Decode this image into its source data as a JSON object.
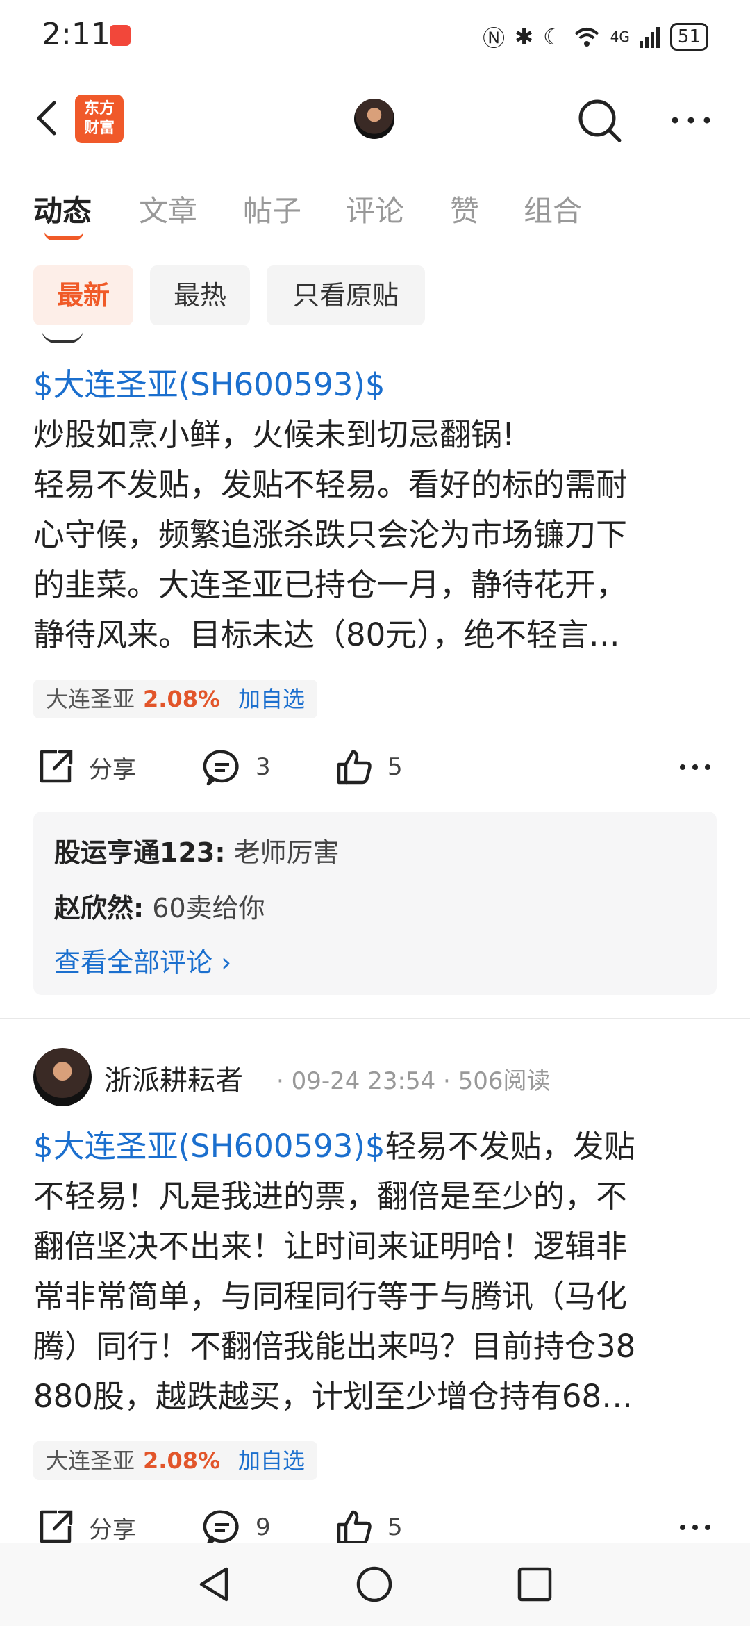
{
  "status": {
    "time": "2:11",
    "battery": "51",
    "network": "4G"
  },
  "header": {
    "logo_line1": "东方",
    "logo_line2": "财富"
  },
  "tabs": [
    {
      "label": "动态",
      "active": true
    },
    {
      "label": "文章"
    },
    {
      "label": "帖子"
    },
    {
      "label": "评论"
    },
    {
      "label": "赞"
    },
    {
      "label": "组合"
    }
  ],
  "filters": [
    {
      "label": "最新",
      "active": true
    },
    {
      "label": "最热"
    },
    {
      "label": "只看原贴"
    }
  ],
  "post1": {
    "link": "$大连圣亚(SH600593)$",
    "line1": "炒股如烹小鲜，火候未到切忌翻锅!",
    "line2": "轻易不发贴，发贴不轻易。看好的标的需耐",
    "line3": "心守候，频繁追涨杀跌只会沦为市场镰刀下",
    "line4": "的韭菜。大连圣亚已持仓一月，静待花开，",
    "line5": "静待风来。目标未达（80元），绝不轻言…",
    "stock": {
      "name": "大连圣亚",
      "change": "2.08%",
      "add": "加自选"
    },
    "actions": {
      "share": "分享",
      "comments": "3",
      "likes": "5"
    },
    "comments": [
      {
        "user": "股运亨通123:",
        "text": "老师厉害"
      },
      {
        "user": "赵欣然:",
        "text": "60卖给你"
      }
    ],
    "view_all": "查看全部评论 ›"
  },
  "post2": {
    "author": "浙派耕耘者",
    "meta": "· 09-24 23:54 · 506阅读",
    "link": "$大连圣亚(SH600593)$",
    "line1_rest": "轻易不发贴，发贴",
    "line2": "不轻易！凡是我进的票，翻倍是至少的，不",
    "line3": "翻倍坚决不出来！让时间来证明哈！逻辑非",
    "line4": "常非常简单，与同程同行等于与腾讯（马化",
    "line5": "腾）同行！不翻倍我能出来吗？目前持仓38",
    "line6": "880股，越跌越买，计划至少增仓持有68…",
    "stock": {
      "name": "大连圣亚",
      "change": "2.08%",
      "add": "加自选"
    },
    "actions": {
      "share": "分享",
      "comments": "9",
      "likes": "5"
    }
  }
}
